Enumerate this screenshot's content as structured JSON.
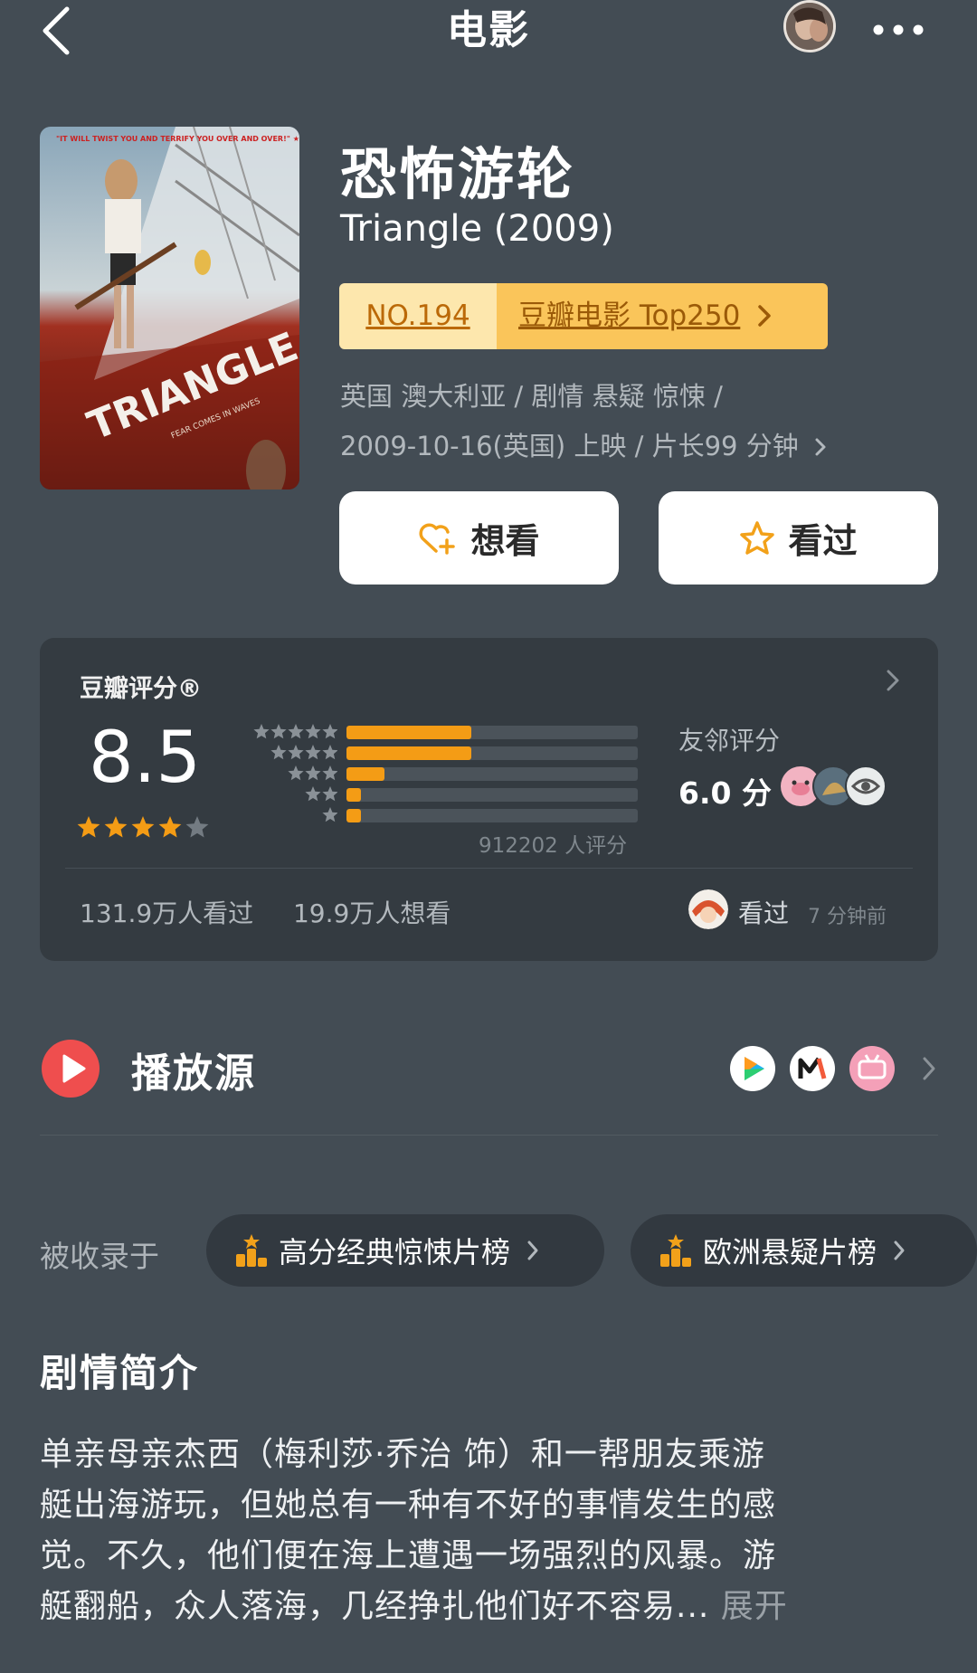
{
  "nav": {
    "title": "电影"
  },
  "movie": {
    "title": "恐怖游轮",
    "original_title": "Triangle (2009)",
    "poster_text": {
      "title": "TRIANGLE",
      "quote": "\"IT WILL TWIST YOU AND TERRIFY YOU OVER AND OVER!\" ★★★★★",
      "tagline": "FEAR COMES IN WAVES"
    },
    "rank": {
      "number": "NO.194",
      "list": "豆瓣电影 Top250"
    },
    "meta_line1": "英国 澳大利亚 / 剧情 悬疑 惊悚 /",
    "meta_line2": "2009-10-16(英国) 上映 / 片长99 分钟"
  },
  "actions": {
    "want": "想看",
    "seen": "看过"
  },
  "rating": {
    "label": "豆瓣评分®",
    "score": "8.5",
    "stars": 4,
    "distribution": [
      0.43,
      0.43,
      0.13,
      0.05,
      0.05
    ],
    "count_text": "912202 人评分",
    "friend_label": "友邻评分",
    "friend_score": "6.0 分",
    "seen_count": "131.9万人看过",
    "want_count": "19.9万人想看",
    "my_status": "看过",
    "my_time": "7 分钟前"
  },
  "play_source": {
    "label": "播放源",
    "sources": [
      "tencent-video-icon",
      "mgtv-icon",
      "bilibili-icon"
    ]
  },
  "collected": {
    "label": "被收录于",
    "chips": [
      "高分经典惊悚片榜",
      "欧洲悬疑片榜"
    ]
  },
  "synopsis": {
    "heading": "剧情简介",
    "lines": [
      "单亲母亲杰西（梅利莎·乔治 饰）和一帮朋友乘游",
      "艇出海游玩，但她总有一种有不好的事情发生的感",
      "觉。不久，他们便在海上遭遇一场强烈的风暴。游",
      "艇翻船，众人落海，几经挣扎他们好不容易..."
    ],
    "expand": "展开"
  },
  "colors": {
    "background": "#434c54",
    "card": "#343b41",
    "accent": "#f49c15",
    "play_red": "#ef4e4e"
  }
}
